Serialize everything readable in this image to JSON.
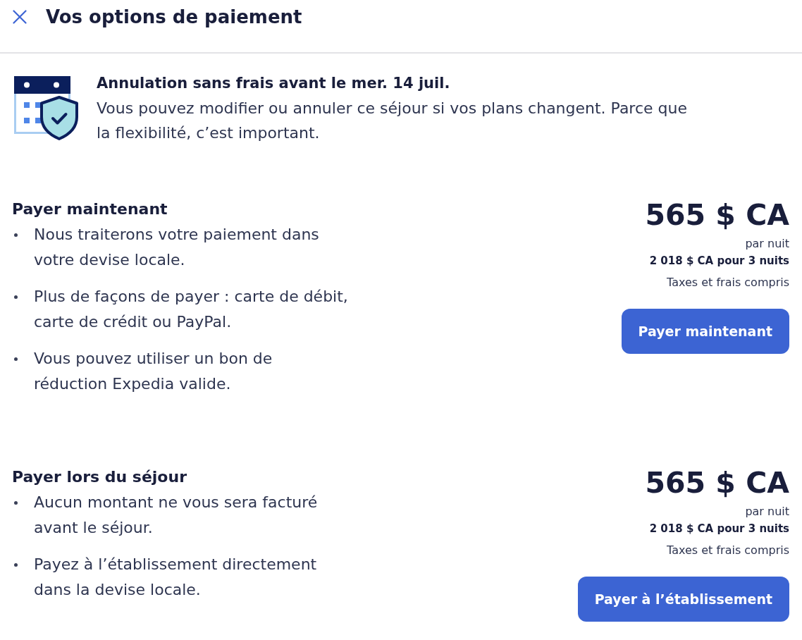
{
  "header": {
    "title": "Vos options de paiement"
  },
  "cancellation_notice": {
    "title": "Annulation sans frais avant le mer. 14 juil.",
    "text": "Vous pouvez modifier ou annuler ce séjour si vos plans changent. Parce que la flexibilité, c’est important."
  },
  "payment_options": [
    {
      "title": "Payer maintenant",
      "points": [
        "Nous traiterons votre paiement dans votre devise locale.",
        "Plus de façons de payer : carte de débit, carte de crédit ou PayPal.",
        "Vous pouvez utiliser un bon de réduction Expedia valide."
      ],
      "price": "565 $ CA",
      "price_unit": "par nuit",
      "total": "2 018 $ CA pour 3 nuits",
      "taxes_note": "Taxes et frais compris",
      "button": "Payer maintenant"
    },
    {
      "title": "Payer lors du séjour",
      "points": [
        "Aucun montant ne vous sera facturé avant le séjour.",
        "Payez à l’établissement directement dans la devise locale."
      ],
      "price": "565 $ CA",
      "price_unit": "par nuit",
      "total": "2 018 $ CA pour 3 nuits",
      "taxes_note": "Taxes et frais compris",
      "button": "Payer à l’établissement"
    }
  ]
}
